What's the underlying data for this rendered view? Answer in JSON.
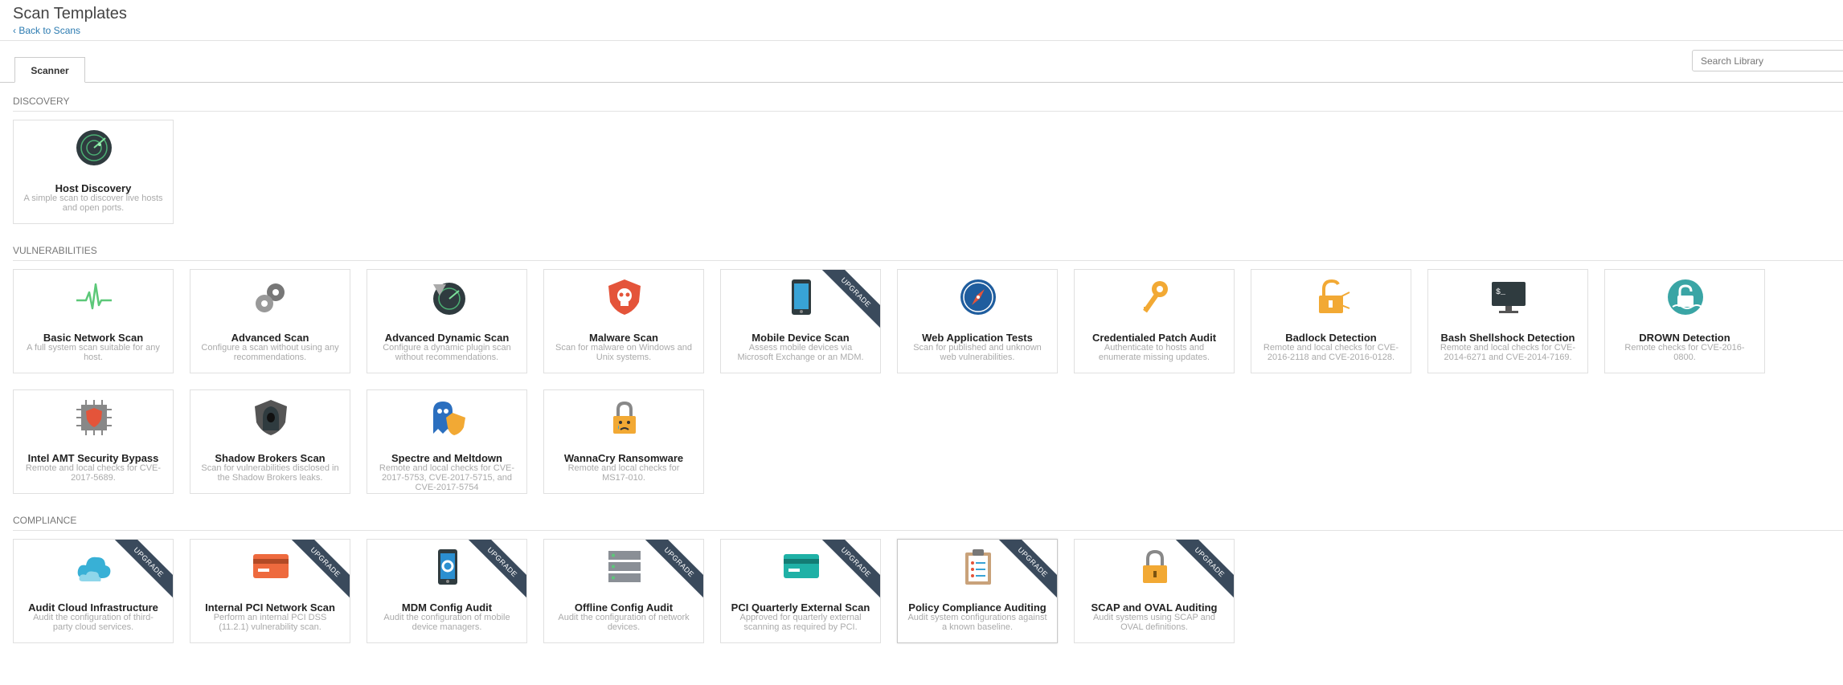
{
  "header": {
    "title": "Scan Templates",
    "back_label": "‹ Back to Scans"
  },
  "tabs": [
    {
      "label": "Scanner"
    }
  ],
  "search": {
    "placeholder": "Search Library"
  },
  "sections": {
    "discovery": "DISCOVERY",
    "vulnerabilities": "VULNERABILITIES",
    "compliance": "COMPLIANCE"
  },
  "ribbon_label": "Upgrade",
  "discovery_cards": [
    {
      "name": "Host Discovery",
      "desc": "A simple scan to discover live hosts and open ports.",
      "icon": "radar-icon"
    }
  ],
  "vulnerability_cards": [
    {
      "name": "Basic Network Scan",
      "desc": "A full system scan suitable for any host.",
      "icon": "pulse-icon"
    },
    {
      "name": "Advanced Scan",
      "desc": "Configure a scan without using any recommendations.",
      "icon": "gears-icon"
    },
    {
      "name": "Advanced Dynamic Scan",
      "desc": "Configure a dynamic plugin scan without recommendations.",
      "icon": "dynamic-radar-icon"
    },
    {
      "name": "Malware Scan",
      "desc": "Scan for malware on Windows and Unix systems.",
      "icon": "skull-shield-icon"
    },
    {
      "name": "Mobile Device Scan",
      "desc": "Assess mobile devices via Microsoft Exchange or an MDM.",
      "icon": "mobile-phone-icon",
      "upgrade": true
    },
    {
      "name": "Web Application Tests",
      "desc": "Scan for published and unknown web vulnerabilities.",
      "icon": "compass-icon"
    },
    {
      "name": "Credentialed Patch Audit",
      "desc": "Authenticate to hosts and enumerate missing updates.",
      "icon": "keys-icon"
    },
    {
      "name": "Badlock Detection",
      "desc": "Remote and local checks for CVE-2016-2118 and CVE-2016-0128.",
      "icon": "broken-lock-icon"
    },
    {
      "name": "Bash Shellshock Detection",
      "desc": "Remote and local checks for CVE-2014-6271 and CVE-2014-7169.",
      "icon": "terminal-monitor-icon"
    },
    {
      "name": "DROWN Detection",
      "desc": "Remote checks for CVE-2016-0800.",
      "icon": "drown-lock-icon"
    },
    {
      "name": "Intel AMT Security Bypass",
      "desc": "Remote and local checks for CVE-2017-5689.",
      "icon": "chip-shield-icon"
    },
    {
      "name": "Shadow Brokers Scan",
      "desc": "Scan for vulnerabilities disclosed in the Shadow Brokers leaks.",
      "icon": "hooded-figure-icon"
    },
    {
      "name": "Spectre and Meltdown",
      "desc": "Remote and local checks for CVE-2017-5753, CVE-2017-5715, and CVE-2017-5754",
      "icon": "ghost-shield-icon"
    },
    {
      "name": "WannaCry Ransomware",
      "desc": "Remote and local checks for MS17-010.",
      "icon": "crying-lock-icon"
    }
  ],
  "compliance_cards": [
    {
      "name": "Audit Cloud Infrastructure",
      "desc": "Audit the configuration of third-party cloud services.",
      "icon": "cloud-icon",
      "upgrade": true
    },
    {
      "name": "Internal PCI Network Scan",
      "desc": "Perform an internal PCI DSS (11.2.1) vulnerability scan.",
      "icon": "credit-card-icon",
      "upgrade": true
    },
    {
      "name": "MDM Config Audit",
      "desc": "Audit the configuration of mobile device managers.",
      "icon": "mobile-gear-icon",
      "upgrade": true
    },
    {
      "name": "Offline Config Audit",
      "desc": "Audit the configuration of network devices.",
      "icon": "server-rack-icon",
      "upgrade": true
    },
    {
      "name": "PCI Quarterly External Scan",
      "desc": "Approved for quarterly external scanning as required by PCI.",
      "icon": "credit-card-teal-icon",
      "upgrade": true
    },
    {
      "name": "Policy Compliance Auditing",
      "desc": "Audit system configurations against a known baseline.",
      "icon": "clipboard-icon",
      "upgrade": true,
      "selected": true
    },
    {
      "name": "SCAP and OVAL Auditing",
      "desc": "Audit systems using SCAP and OVAL definitions.",
      "icon": "padlock-icon",
      "upgrade": true
    }
  ]
}
